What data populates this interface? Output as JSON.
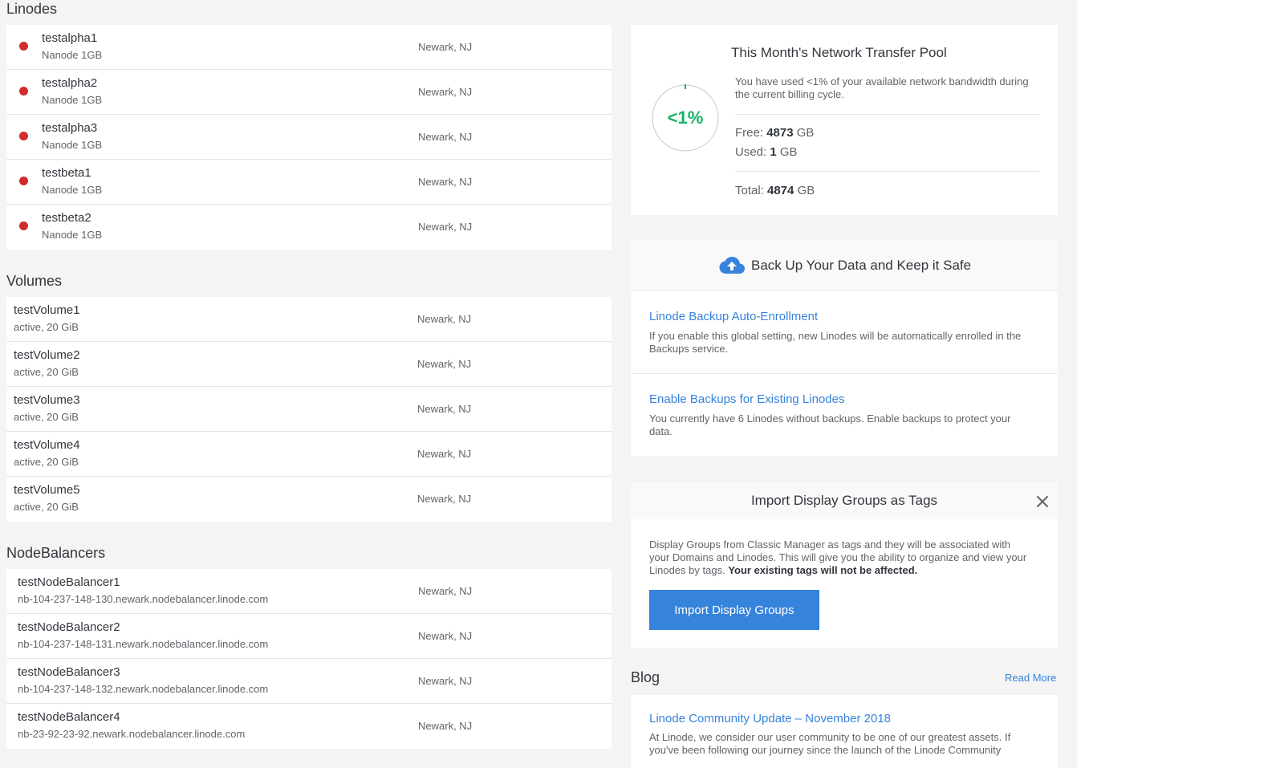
{
  "linodes": {
    "title": "Linodes",
    "items": [
      {
        "name": "testalpha1",
        "plan": "Nanode 1GB",
        "region": "Newark, NJ"
      },
      {
        "name": "testalpha2",
        "plan": "Nanode 1GB",
        "region": "Newark, NJ"
      },
      {
        "name": "testalpha3",
        "plan": "Nanode 1GB",
        "region": "Newark, NJ"
      },
      {
        "name": "testbeta1",
        "plan": "Nanode 1GB",
        "region": "Newark, NJ"
      },
      {
        "name": "testbeta2",
        "plan": "Nanode 1GB",
        "region": "Newark, NJ"
      }
    ]
  },
  "volumes": {
    "title": "Volumes",
    "items": [
      {
        "name": "testVolume1",
        "detail": "active, 20 GiB",
        "region": "Newark, NJ"
      },
      {
        "name": "testVolume2",
        "detail": "active, 20 GiB",
        "region": "Newark, NJ"
      },
      {
        "name": "testVolume3",
        "detail": "active, 20 GiB",
        "region": "Newark, NJ"
      },
      {
        "name": "testVolume4",
        "detail": "active, 20 GiB",
        "region": "Newark, NJ"
      },
      {
        "name": "testVolume5",
        "detail": "active, 20 GiB",
        "region": "Newark, NJ"
      }
    ]
  },
  "nodebalancers": {
    "title": "NodeBalancers",
    "items": [
      {
        "name": "testNodeBalancer1",
        "hostname": "nb-104-237-148-130.newark.nodebalancer.linode.com",
        "region": "Newark, NJ"
      },
      {
        "name": "testNodeBalancer2",
        "hostname": "nb-104-237-148-131.newark.nodebalancer.linode.com",
        "region": "Newark, NJ"
      },
      {
        "name": "testNodeBalancer3",
        "hostname": "nb-104-237-148-132.newark.nodebalancer.linode.com",
        "region": "Newark, NJ"
      },
      {
        "name": "testNodeBalancer4",
        "hostname": "nb-23-92-23-92.newark.nodebalancer.linode.com",
        "region": "Newark, NJ"
      }
    ]
  },
  "transfer": {
    "title": "This Month's Network Transfer Pool",
    "gauge_label": "<1%",
    "used_fraction": 0.0002,
    "description": "You have used <1% of your available network bandwidth during the current billing cycle.",
    "free_label": "Free:",
    "free_value": "4873",
    "used_label": "Used:",
    "used_value": "1",
    "total_label": "Total:",
    "total_value": "4874",
    "unit": "GB",
    "gauge_color": "#17b364"
  },
  "backups": {
    "title": "Back Up Your Data and Keep it Safe",
    "icon": "cloud-upload-icon",
    "auto_enroll_title": "Linode Backup Auto-Enrollment",
    "auto_enroll_text": "If you enable this global setting, new Linodes will be automatically enrolled in the Backups service.",
    "existing_title": "Enable Backups for Existing Linodes",
    "existing_text": "You currently have 6 Linodes without backups. Enable backups to protect your data."
  },
  "import_groups": {
    "title": "Import Display Groups as Tags",
    "text": "Display Groups from Classic Manager as tags and they will be associated with your Domains and Linodes. This will give you the ability to organize and view your Linodes by tags.",
    "text_bold": "Your existing tags will not be affected.",
    "button_label": "Import Display Groups",
    "close_icon": "close-icon"
  },
  "blog": {
    "title": "Blog",
    "read_more": "Read More",
    "post_title": "Linode Community Update – November 2018",
    "post_excerpt": "At Linode, we consider our user community to be one of our greatest assets. If you've been following our journey since the launch of the Linode Community"
  },
  "colors": {
    "accent": "#3683dc",
    "status_offline": "#d22b2b",
    "success": "#17b364"
  }
}
